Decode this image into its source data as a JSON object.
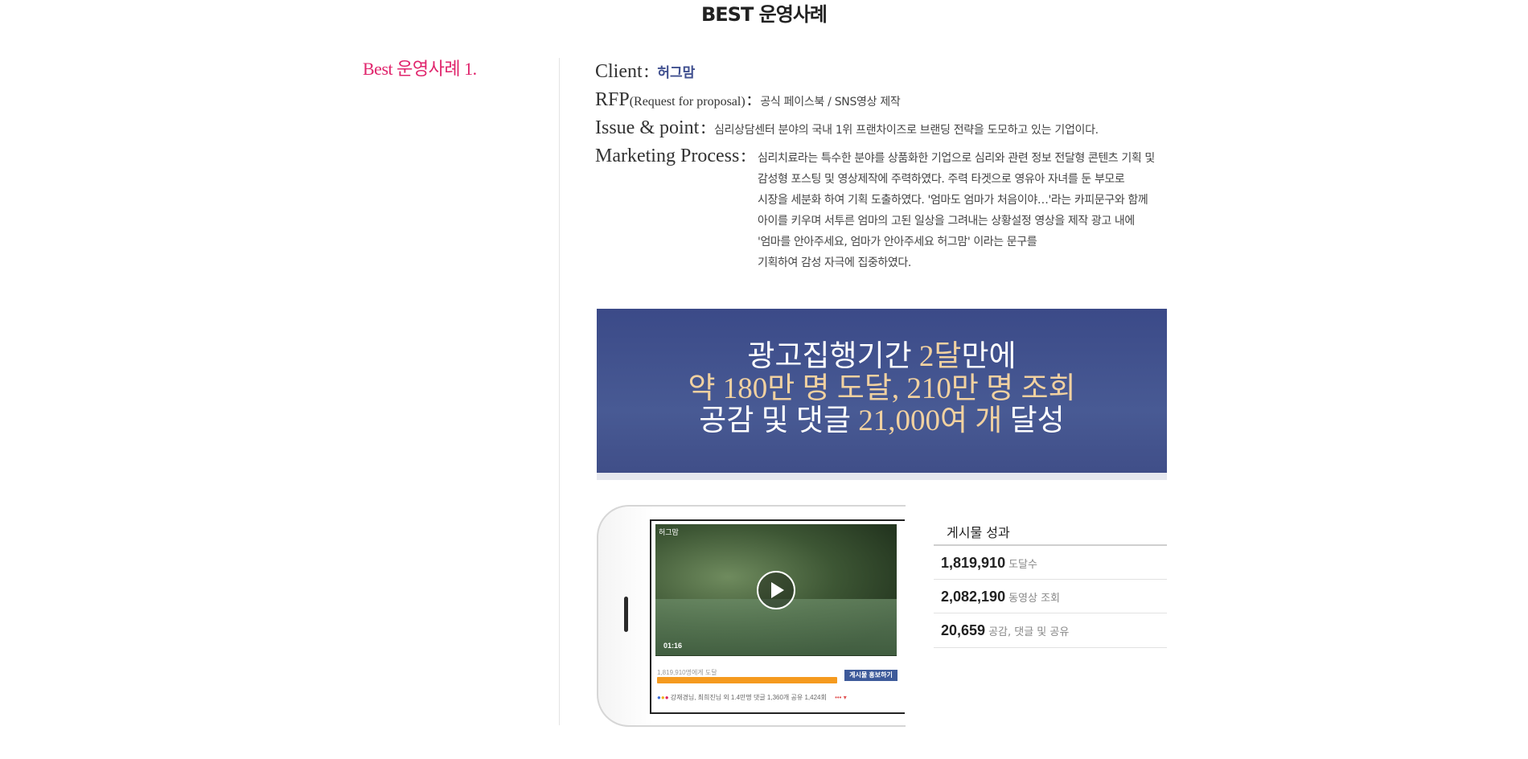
{
  "page_title": "BEST 운영사례",
  "case_label": "Best 운영사례 1.",
  "client": {
    "key": "Client",
    "value": "허그맘"
  },
  "rfp": {
    "key": "RFP",
    "key_sub": "(Request for proposal)",
    "value": "공식 페이스북 / SNS영상 제작"
  },
  "issue": {
    "key": "Issue & point",
    "value": "심리상담센터 분야의 국내 1위 프랜차이즈로 브랜딩 전략을 도모하고 있는 기업이다."
  },
  "process": {
    "key": "Marketing Process",
    "lines": [
      "심리치료라는 특수한 분야를 상품화한 기업으로 심리와 관련 정보 전달형 콘텐츠 기획 및",
      "감성형 포스팅 및 영상제작에 주력하였다. 주력 타겟으로 영유아 자녀를 둔 부모로",
      "시장을 세분화 하여 기획 도출하였다. '엄마도 엄마가 처음이야…'라는 카피문구와 함께",
      "아이를 키우며 서투른 엄마의 고된 일상을 그려내는 상황설정 영상을 제작 광고 내에",
      "'엄마를 안아주세요, 엄마가 안아주세요 허그맘' 이라는 문구를",
      "기획하여 감성 자극에 집중하였다."
    ]
  },
  "banner": {
    "line1_a": "광고집행기간 ",
    "line1_b": "2달",
    "line1_c": "만에",
    "line2": "약 180만 명 도달, 210만 명 조회",
    "line3_a": "공감 및 댓글 ",
    "line3_b": "21,000여 개",
    "line3_c": " 달성"
  },
  "video": {
    "logo": "허그맘",
    "time": "01:16",
    "reach_text": "1,819,910명에게 도달",
    "boost_label": "게시물 홍보하기",
    "reactions_text": "강재경님, 최희진님 외 1.4만명   댓글 1,360개  공유 1,424회"
  },
  "stats": {
    "title": "게시물 성과",
    "items": [
      {
        "value": "1,819,910",
        "label": "도달수"
      },
      {
        "value": "2,082,190",
        "label": "동영상 조회"
      },
      {
        "value": "20,659",
        "label": "공감, 댓글 및 공유"
      }
    ]
  }
}
